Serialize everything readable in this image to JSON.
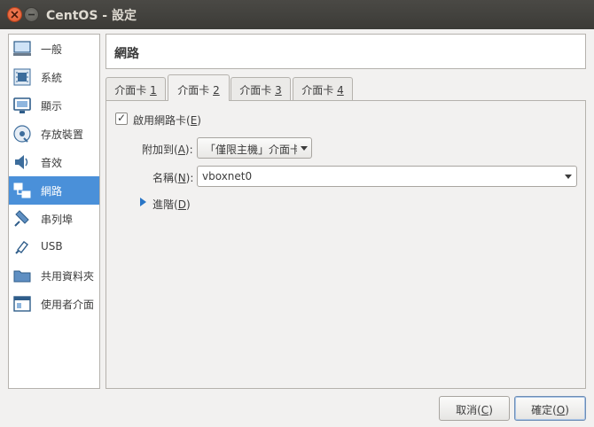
{
  "window": {
    "title": "CentOS - 設定"
  },
  "sidebar": {
    "items": [
      {
        "label": "一般",
        "icon": "computer-icon"
      },
      {
        "label": "系統",
        "icon": "chip-icon"
      },
      {
        "label": "顯示",
        "icon": "monitor-icon"
      },
      {
        "label": "存放裝置",
        "icon": "disk-icon"
      },
      {
        "label": "音效",
        "icon": "speaker-icon"
      },
      {
        "label": "網路",
        "icon": "network-icon",
        "active": true
      },
      {
        "label": "串列埠",
        "icon": "serial-port-icon"
      },
      {
        "label": "USB",
        "icon": "usb-icon"
      },
      {
        "label": "共用資料夾",
        "icon": "folder-icon"
      },
      {
        "label": "使用者介面",
        "icon": "ui-window-icon"
      }
    ]
  },
  "header": {
    "title": "網路"
  },
  "tabs": [
    {
      "text": "介面卡 ",
      "mnemonic": "1",
      "active": false
    },
    {
      "text": "介面卡 ",
      "mnemonic": "2",
      "active": true
    },
    {
      "text": "介面卡 ",
      "mnemonic": "3",
      "active": false
    },
    {
      "text": "介面卡 ",
      "mnemonic": "4",
      "active": false
    }
  ],
  "adapter": {
    "enable_label_pre": "啟用網路卡(",
    "enable_mnemonic": "E",
    "enable_label_post": ")",
    "enabled": true,
    "attached_label_pre": "附加到(",
    "attached_mnemonic": "A",
    "attached_label_post": "):",
    "attached_value": "「僅限主機」介面卡",
    "name_label_pre": "名稱(",
    "name_mnemonic": "N",
    "name_label_post": "):",
    "name_value": "vboxnet0",
    "advanced_pre": "進階(",
    "advanced_mnemonic": "D",
    "advanced_post": ")"
  },
  "buttons": {
    "cancel_pre": "取消(",
    "cancel_mnemonic": "C",
    "cancel_post": ")",
    "ok_pre": "確定(",
    "ok_mnemonic": "O",
    "ok_post": ")"
  },
  "colors": {
    "selection": "#4a90d9",
    "titlebar": "#3c3b37",
    "close_button": "#e05a2e"
  }
}
